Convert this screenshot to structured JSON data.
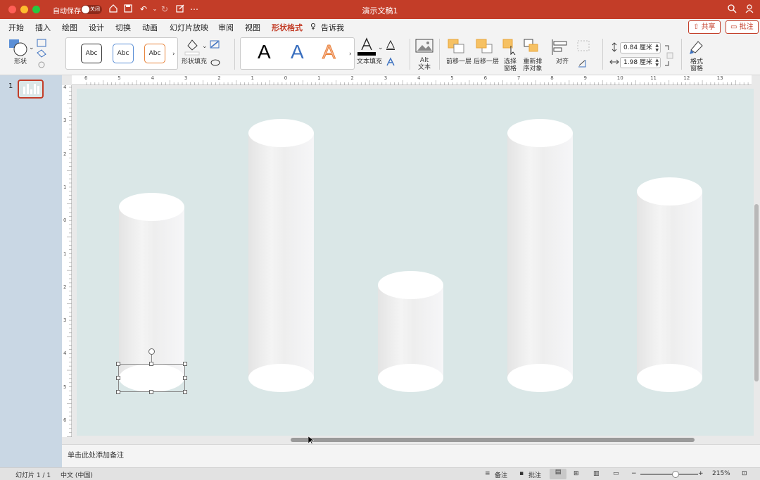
{
  "window": {
    "title": "演示文稿1",
    "autosave_label": "自动保存",
    "autosave_state": "关闭"
  },
  "menu": {
    "tabs": [
      "开始",
      "插入",
      "绘图",
      "设计",
      "切换",
      "动画",
      "幻灯片放映",
      "审阅",
      "视图",
      "形状格式"
    ],
    "tell_me": "告诉我",
    "share_label": "共享",
    "comment_label": "批注"
  },
  "ribbon": {
    "shapes_label": "形状",
    "style_samples": [
      "Abc",
      "Abc",
      "Abc"
    ],
    "shape_fill_label": "形状填充",
    "wordart_samples": [
      "A",
      "A",
      "A"
    ],
    "text_fill_label": "文本填充",
    "alt_text_label": "Alt 文本",
    "bring_forward_label": "前移一层",
    "send_backward_label": "后移一层",
    "selection_pane_label": "选择窗格",
    "reorder_label": "重新排序对象",
    "align_label": "对齐",
    "height_value": "0.84 厘米",
    "width_value": "1.98 厘米",
    "format_pane_label": "格式窗格"
  },
  "thumbnails": [
    {
      "number": "1"
    }
  ],
  "ruler": {
    "horizontal": [
      "6",
      "5",
      "4",
      "3",
      "2",
      "1",
      "0",
      "1",
      "2",
      "3",
      "4",
      "5",
      "6",
      "7",
      "8",
      "9",
      "10",
      "11",
      "12",
      "13"
    ],
    "vertical": [
      "4",
      "3",
      "2",
      "1",
      "0",
      "1",
      "2",
      "3",
      "4",
      "5",
      "6"
    ]
  },
  "notes": {
    "placeholder": "单击此处添加备注"
  },
  "status": {
    "slide_info": "幻灯片 1 / 1",
    "language": "中文 (中国)",
    "notes_label": "备注",
    "comments_label": "批注",
    "zoom": "215%"
  },
  "colors": {
    "accent": "#c33d28",
    "slide_bg": "#dae7e7"
  }
}
